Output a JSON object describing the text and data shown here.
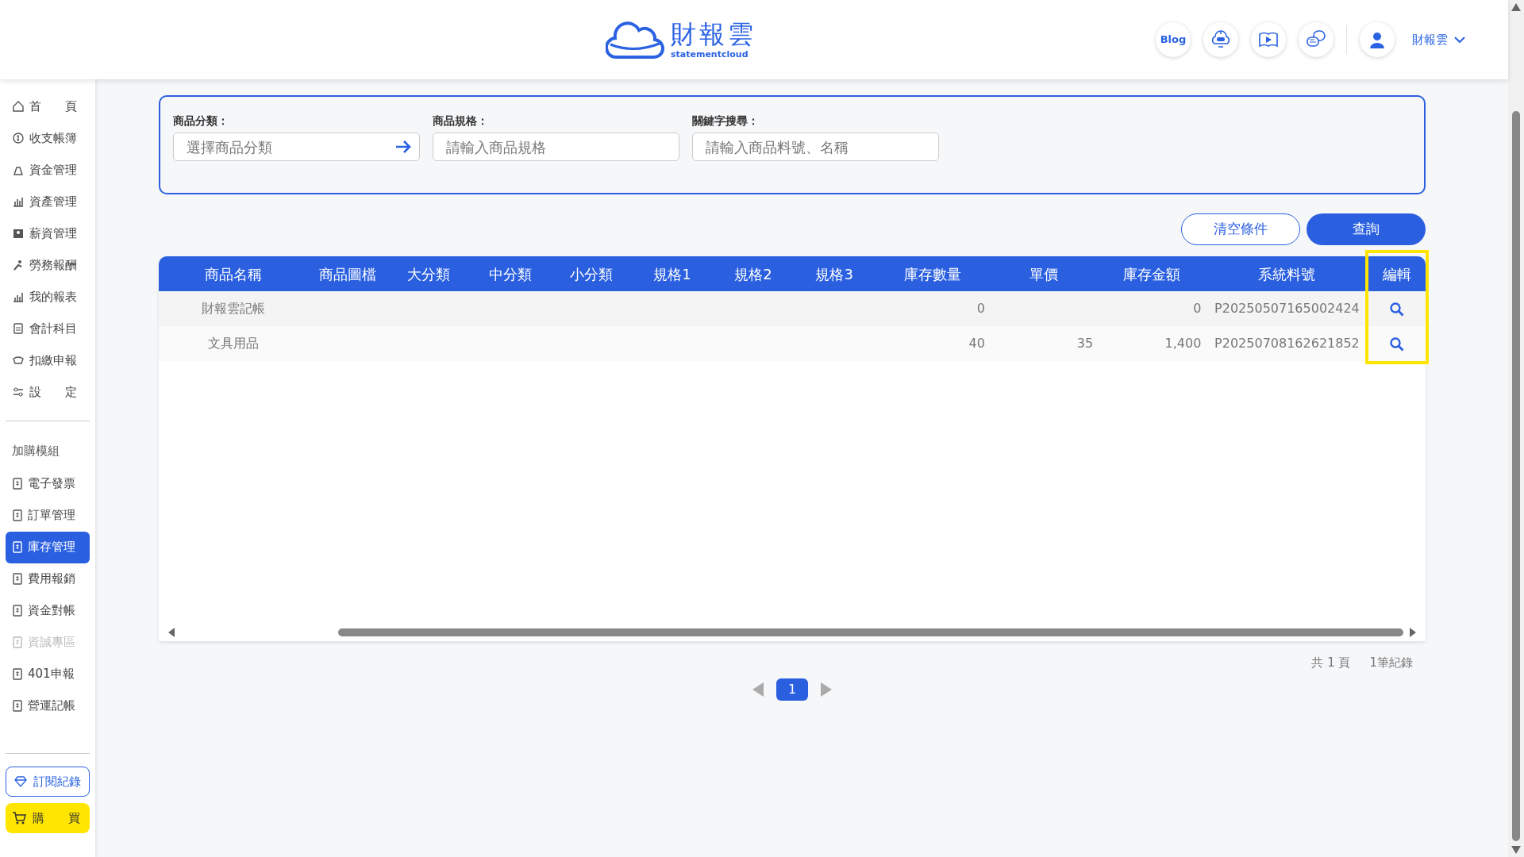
{
  "header": {
    "logo": {
      "name": "財報雲",
      "tagline": "statementcloud"
    },
    "blog": "Blog",
    "user": "財報雲"
  },
  "sidebar": {
    "items": [
      {
        "label": "首　　頁",
        "selected": false,
        "disabled": false
      },
      {
        "label": "收支帳簿",
        "selected": false,
        "disabled": false
      },
      {
        "label": "資金管理",
        "selected": false,
        "disabled": false
      },
      {
        "label": "資產管理",
        "selected": false,
        "disabled": false
      },
      {
        "label": "薪資管理",
        "selected": false,
        "disabled": false
      },
      {
        "label": "勞務報酬",
        "selected": false,
        "disabled": false
      },
      {
        "label": "我的報表",
        "selected": false,
        "disabled": false
      },
      {
        "label": "會計科目",
        "selected": false,
        "disabled": false
      },
      {
        "label": "扣繳申報",
        "selected": false,
        "disabled": false
      },
      {
        "label": "設　　定",
        "selected": false,
        "disabled": false
      }
    ],
    "addon_heading": "加購模組",
    "addons": [
      {
        "label": "電子發票",
        "selected": false,
        "disabled": false
      },
      {
        "label": "訂單管理",
        "selected": false,
        "disabled": false
      },
      {
        "label": "庫存管理",
        "selected": true,
        "disabled": false
      },
      {
        "label": "費用報銷",
        "selected": false,
        "disabled": false
      },
      {
        "label": "資金對帳",
        "selected": false,
        "disabled": false
      },
      {
        "label": "資誠專區",
        "selected": false,
        "disabled": true
      },
      {
        "label": "401申報",
        "selected": false,
        "disabled": false
      },
      {
        "label": "營運記帳",
        "selected": false,
        "disabled": false
      }
    ],
    "subscribe": "訂閱紀錄",
    "buy": "購　　買"
  },
  "filters": [
    {
      "label": "商品分類：",
      "placeholder": "選擇商品分類",
      "kind": "select"
    },
    {
      "label": "商品規格：",
      "placeholder": "請輸入商品規格",
      "kind": "text"
    },
    {
      "label": "關鍵字搜尋：",
      "placeholder": "請輸入商品料號、名稱",
      "kind": "text"
    }
  ],
  "buttons": {
    "clear": "清空條件",
    "query": "查詢"
  },
  "table": {
    "columns": [
      {
        "label": "商品名稱",
        "kind": "text",
        "highlighted": false
      },
      {
        "label": "商品圖檔",
        "kind": "text",
        "highlighted": false
      },
      {
        "label": "大分類",
        "kind": "text",
        "highlighted": false
      },
      {
        "label": "中分類",
        "kind": "text",
        "highlighted": false
      },
      {
        "label": "小分類",
        "kind": "text",
        "highlighted": false
      },
      {
        "label": "規格1",
        "kind": "text",
        "highlighted": false
      },
      {
        "label": "規格2",
        "kind": "text",
        "highlighted": false
      },
      {
        "label": "規格3",
        "kind": "text",
        "highlighted": false
      },
      {
        "label": "庫存數量",
        "kind": "number",
        "highlighted": false
      },
      {
        "label": "單價",
        "kind": "number",
        "highlighted": false
      },
      {
        "label": "庫存金額",
        "kind": "number",
        "highlighted": false
      },
      {
        "label": "系統料號",
        "kind": "text",
        "highlighted": false
      },
      {
        "label": "編輯",
        "kind": "action",
        "highlighted": true
      }
    ],
    "rows": [
      {
        "cells": [
          "財報雲記帳",
          null,
          null,
          null,
          null,
          null,
          null,
          null,
          "0",
          null,
          "0",
          "P20250507165002424",
          null
        ]
      },
      {
        "cells": [
          "文具用品",
          null,
          null,
          null,
          null,
          null,
          null,
          null,
          "40",
          "35",
          "1,400",
          "P20250708162621852",
          null
        ]
      }
    ]
  },
  "pagination": {
    "total_pages": "共 1 頁",
    "records": "1筆紀錄",
    "pages": [
      {
        "label": "1",
        "selected": true
      }
    ]
  }
}
